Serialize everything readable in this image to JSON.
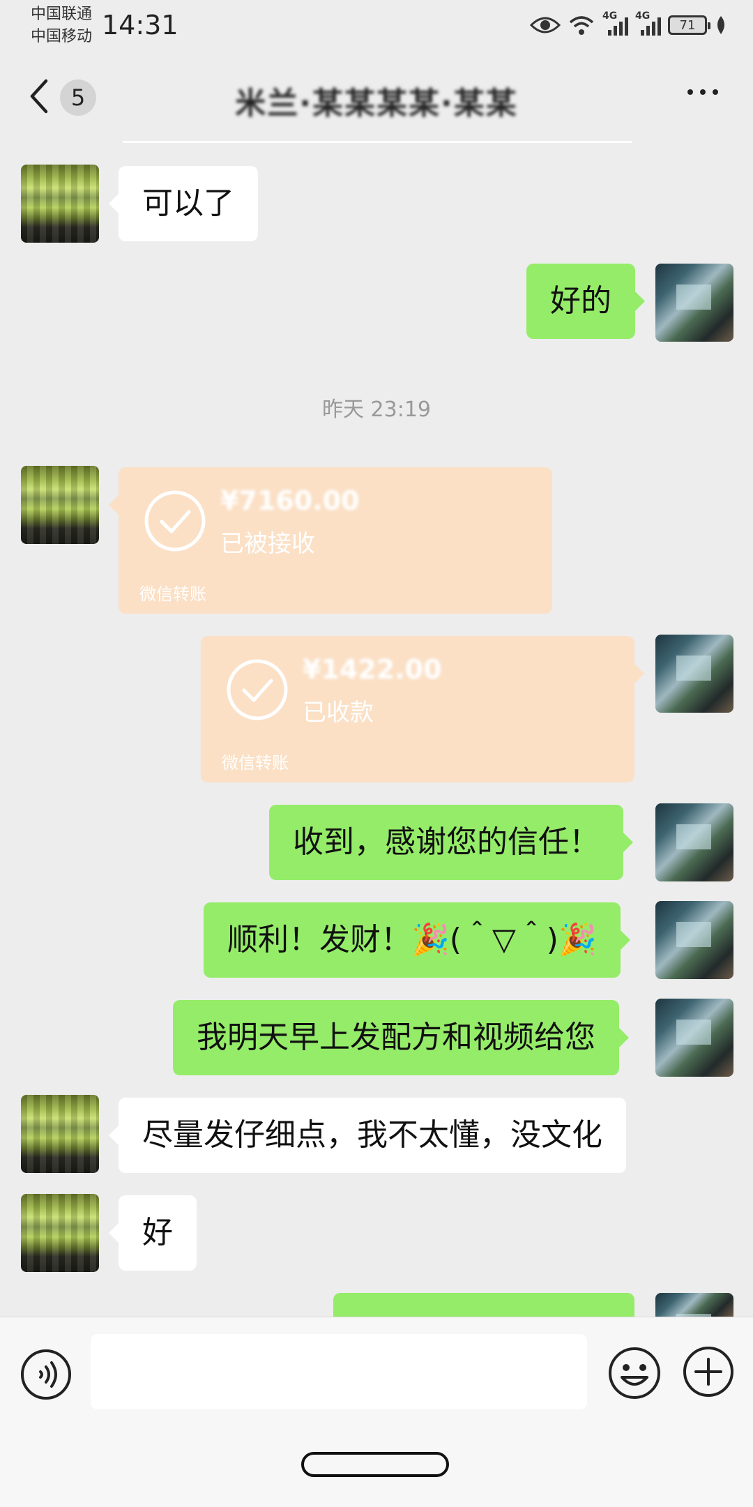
{
  "status_bar": {
    "carrier_1": "中国联通",
    "carrier_2": "中国移动",
    "time": "14:31",
    "network_1": "4G",
    "network_2": "4G",
    "battery": "71"
  },
  "nav": {
    "unread_count": "5",
    "title": "米兰·某某某某·某某"
  },
  "chat": {
    "msg_1": "可以了",
    "msg_2": "好的",
    "time_divider": "昨天 23:19",
    "transfer_1": {
      "amount": "¥7160.00",
      "status": "已被接收",
      "label": "微信转账"
    },
    "transfer_2": {
      "amount": "¥1422.00",
      "status": "已收款",
      "label": "微信转账"
    },
    "msg_3": "收到，感谢您的信任！",
    "msg_4": "顺利！发财！🎉(＾▽＾)🎉",
    "msg_5": "我明天早上发配方和视频给您",
    "msg_6": "尽量发仔细点，我不太懂，没文化",
    "msg_7": "好"
  },
  "input_bar": {
    "input_value": ""
  },
  "colors": {
    "background": "#ededed",
    "self_bubble": "#95ec69",
    "friend_bubble": "#ffffff",
    "transfer": "#fbe0c6"
  }
}
